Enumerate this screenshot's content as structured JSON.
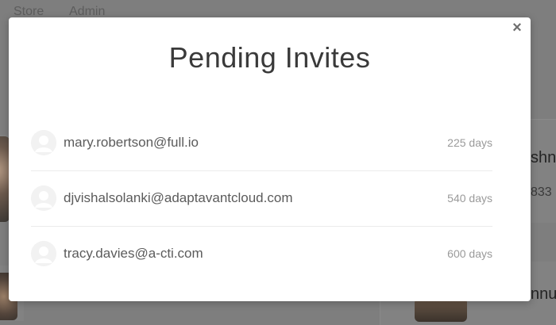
{
  "background": {
    "nav": {
      "store_label": "Store",
      "admin_label": "Admin"
    },
    "fragments": {
      "name_top": "shna",
      "number_top": "833",
      "name_bottom": "nnu"
    }
  },
  "modal": {
    "title": "Pending Invites",
    "close_icon": "close-icon",
    "close_glyph": "×",
    "invites": [
      {
        "email": "mary.robertson@full.io",
        "age": "225 days",
        "avatar_icon": "user-avatar-icon"
      },
      {
        "email": "djvishalsolanki@adaptavantcloud.com",
        "age": "540 days",
        "avatar_icon": "user-avatar-icon"
      },
      {
        "email": "tracy.davies@a-cti.com",
        "age": "600 days",
        "avatar_icon": "user-avatar-icon"
      }
    ]
  },
  "colors": {
    "overlay": "#7e7e7e",
    "modal_background": "#ffffff",
    "title_text": "#3a3a3a",
    "email_text": "#5b5b5b",
    "age_text": "#9a9a9a",
    "divider": "#ebebeb"
  }
}
